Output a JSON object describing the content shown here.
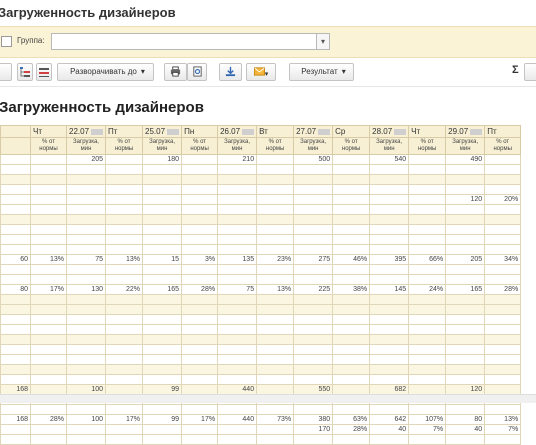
{
  "window": {
    "title": "Загруженность дизайнеров"
  },
  "filter": {
    "group_label": "Группа:",
    "group_value": "",
    "dropdown_icon": "▾"
  },
  "toolbar": {
    "expand_label": "Разворачивать до",
    "result_label": "Результат",
    "sum_label": "Σ"
  },
  "report": {
    "title": "Загруженность дизайнеров"
  },
  "table": {
    "header": [
      {
        "text": "",
        "blur": false
      },
      {
        "text": "Чт",
        "blur": false
      },
      {
        "text": "22.07",
        "blur": true
      },
      {
        "text": "Пт",
        "blur": false
      },
      {
        "text": "25.07",
        "blur": true
      },
      {
        "text": "Пн",
        "blur": false
      },
      {
        "text": "26.07",
        "blur": true
      },
      {
        "text": "Вт",
        "blur": false
      },
      {
        "text": "27.07",
        "blur": true
      },
      {
        "text": "Ср",
        "blur": false
      },
      {
        "text": "28.07",
        "blur": true
      },
      {
        "text": "Чт",
        "blur": false
      },
      {
        "text": "29.07",
        "blur": true
      },
      {
        "text": "Пт",
        "blur": false
      }
    ],
    "subheader": [
      "",
      "% от нормы",
      "Загрузка, мин",
      "% от нормы",
      "Загрузка, мин",
      "% от нормы",
      "Загрузка, мин",
      "% от нормы",
      "Загрузка, мин",
      "% от нормы",
      "Загрузка, мин",
      "% от нормы",
      "Загрузка, мин",
      "% от нормы"
    ],
    "rows": [
      {
        "band": false,
        "cells": [
          [
            "",
            ""
          ],
          [
            "",
            ""
          ],
          [
            "205",
            ""
          ],
          [
            "",
            ""
          ],
          [
            "180",
            ""
          ],
          [
            "",
            ""
          ],
          [
            "210",
            ""
          ],
          [
            "",
            ""
          ],
          [
            "500",
            ""
          ],
          [
            "",
            ""
          ],
          [
            "540",
            ""
          ],
          [
            "",
            ""
          ],
          [
            "490",
            ""
          ],
          [
            "",
            ""
          ]
        ]
      },
      {
        "band": false,
        "cells": [
          [
            "",
            ""
          ]
        ]
      },
      {
        "band": true,
        "cells": [
          [
            "",
            ""
          ]
        ]
      },
      {
        "band": false,
        "cells": [
          [
            "",
            ""
          ]
        ]
      },
      {
        "band": false,
        "cells": [
          [
            "",
            ""
          ],
          [
            "",
            ""
          ],
          [
            "",
            ""
          ],
          [
            "",
            ""
          ],
          [
            "",
            ""
          ],
          [
            "",
            ""
          ],
          [
            "",
            ""
          ],
          [
            "",
            ""
          ],
          [
            "",
            ""
          ],
          [
            "",
            ""
          ],
          [
            "",
            ""
          ],
          [
            "",
            ""
          ],
          [
            "120",
            "g"
          ],
          [
            "20%",
            ""
          ]
        ]
      },
      {
        "band": false,
        "cells": [
          [
            "",
            ""
          ]
        ]
      },
      {
        "band": true,
        "cells": [
          [
            "",
            ""
          ]
        ]
      },
      {
        "band": false,
        "cells": [
          [
            "",
            ""
          ]
        ]
      },
      {
        "band": false,
        "cells": [
          [
            "",
            ""
          ]
        ]
      },
      {
        "band": false,
        "cells": [
          [
            "",
            ""
          ]
        ]
      },
      {
        "band": false,
        "cells": [
          [
            "60",
            "g"
          ],
          [
            "13%",
            ""
          ],
          [
            "75",
            "g"
          ],
          [
            "13%",
            ""
          ],
          [
            "15",
            "g"
          ],
          [
            "3%",
            ""
          ],
          [
            "135",
            "g"
          ],
          [
            "23%",
            ""
          ],
          [
            "275",
            "o"
          ],
          [
            "46%",
            ""
          ],
          [
            "395",
            "r"
          ],
          [
            "66%",
            ""
          ],
          [
            "205",
            "g"
          ],
          [
            "34%",
            ""
          ]
        ]
      },
      {
        "band": false,
        "cells": [
          [
            "",
            ""
          ]
        ]
      },
      {
        "band": false,
        "cells": [
          [
            "",
            ""
          ]
        ]
      },
      {
        "band": false,
        "cells": [
          [
            "80",
            "g"
          ],
          [
            "17%",
            ""
          ],
          [
            "130",
            "g"
          ],
          [
            "22%",
            ""
          ],
          [
            "165",
            "g"
          ],
          [
            "28%",
            ""
          ],
          [
            "75",
            "g"
          ],
          [
            "13%",
            ""
          ],
          [
            "225",
            "g"
          ],
          [
            "38%",
            ""
          ],
          [
            "145",
            "g"
          ],
          [
            "24%",
            ""
          ],
          [
            "165",
            "g"
          ],
          [
            "28%",
            ""
          ]
        ]
      },
      {
        "band": true,
        "cells": [
          [
            "",
            ""
          ]
        ]
      },
      {
        "band": true,
        "cells": [
          [
            "",
            ""
          ]
        ]
      },
      {
        "band": false,
        "cells": [
          [
            "",
            ""
          ]
        ]
      },
      {
        "band": false,
        "cells": [
          [
            "",
            ""
          ]
        ]
      },
      {
        "band": true,
        "cells": [
          [
            "",
            ""
          ]
        ]
      },
      {
        "band": false,
        "cells": [
          [
            "",
            ""
          ]
        ]
      },
      {
        "band": false,
        "cells": [
          [
            "",
            ""
          ]
        ]
      },
      {
        "band": true,
        "cells": [
          [
            "",
            ""
          ]
        ]
      },
      {
        "band": false,
        "cells": [
          [
            "",
            ""
          ]
        ]
      },
      {
        "band": true,
        "cells": [
          [
            "168",
            ""
          ],
          [
            "",
            ""
          ],
          [
            "100",
            ""
          ],
          [
            "",
            ""
          ],
          [
            "99",
            ""
          ],
          [
            "",
            ""
          ],
          [
            "440",
            ""
          ],
          [
            "",
            ""
          ],
          [
            "550",
            ""
          ],
          [
            "",
            ""
          ],
          [
            "682",
            ""
          ],
          [
            "",
            ""
          ],
          [
            "120",
            ""
          ],
          [
            "",
            ""
          ]
        ]
      },
      {
        "band": false,
        "cells": [
          [
            "",
            ""
          ]
        ]
      },
      {
        "band": false,
        "cells": [
          [
            "",
            ""
          ]
        ]
      },
      {
        "band": false,
        "cells": [
          [
            "168",
            "g"
          ],
          [
            "28%",
            ""
          ],
          [
            "100",
            "g"
          ],
          [
            "17%",
            ""
          ],
          [
            "99",
            "g"
          ],
          [
            "17%",
            ""
          ],
          [
            "440",
            "r"
          ],
          [
            "73%",
            ""
          ],
          [
            "380",
            "r"
          ],
          [
            "63%",
            ""
          ],
          [
            "642",
            "r"
          ],
          [
            "107%",
            ""
          ],
          [
            "80",
            "g"
          ],
          [
            "13%",
            ""
          ]
        ]
      },
      {
        "band": false,
        "cells": [
          [
            "",
            ""
          ],
          [
            "",
            ""
          ],
          [
            "",
            ""
          ],
          [
            "",
            ""
          ],
          [
            "",
            ""
          ],
          [
            "",
            ""
          ],
          [
            "",
            ""
          ],
          [
            "",
            ""
          ],
          [
            "170",
            "g"
          ],
          [
            "28%",
            ""
          ],
          [
            "40",
            "g"
          ],
          [
            "7%",
            ""
          ],
          [
            "40",
            "g"
          ],
          [
            "7%",
            ""
          ]
        ]
      },
      {
        "band": false,
        "cells": [
          [
            "",
            ""
          ]
        ]
      }
    ]
  }
}
